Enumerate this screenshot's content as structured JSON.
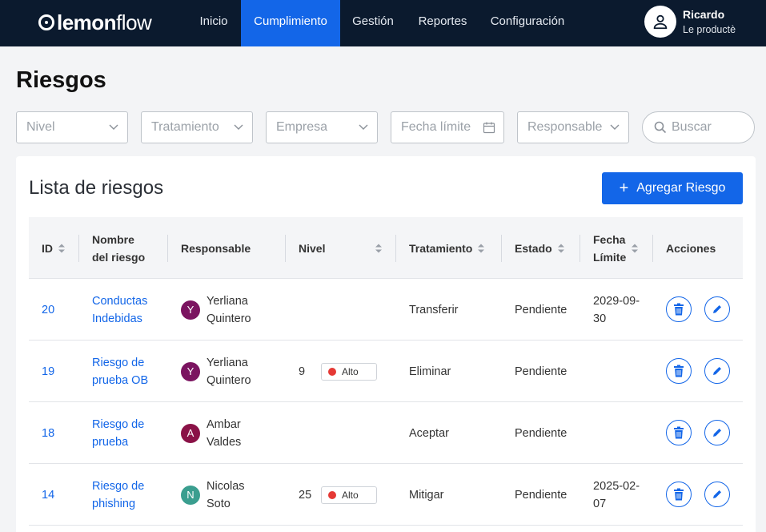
{
  "brand": {
    "logo_bold": "lemon",
    "logo_light": "flow"
  },
  "nav": [
    {
      "label": "Inicio",
      "active": false
    },
    {
      "label": "Cumplimiento",
      "active": true
    },
    {
      "label": "Gestión",
      "active": false
    },
    {
      "label": "Reportes",
      "active": false
    },
    {
      "label": "Configuración",
      "active": false
    }
  ],
  "user": {
    "name": "Ricardo",
    "role": "Le productè",
    "icon": "user-icon"
  },
  "page": {
    "title": "Riesgos"
  },
  "filters": {
    "nivel": "Nivel",
    "tratamiento": "Tratamiento",
    "empresa": "Empresa",
    "fecha_limite": "Fecha límite",
    "responsable": "Responsable",
    "search_placeholder": "Buscar"
  },
  "list": {
    "title": "Lista de riesgos",
    "add_button": "Agregar Riesgo",
    "columns": {
      "id": "ID",
      "nombre_1": "Nombre",
      "nombre_2": "del riesgo",
      "responsable": "Responsable",
      "nivel": "Nivel",
      "tratamiento": "Tratamiento",
      "estado": "Estado",
      "fecha_1": "Fecha",
      "fecha_2": "Límite",
      "acciones": "Acciones"
    },
    "rows": [
      {
        "id": "20",
        "name_1": "Conductas",
        "name_2": "Indebidas",
        "initial": "Y",
        "avatar_color": "#7b1460",
        "resp_1": "Yerliana",
        "resp_2": "Quintero",
        "level_num": "",
        "level_label": "",
        "treatment": "Transferir",
        "status": "Pendiente",
        "date_1": "2029-09-",
        "date_2": "30"
      },
      {
        "id": "19",
        "name_1": "Riesgo de",
        "name_2": "prueba OB",
        "initial": "Y",
        "avatar_color": "#7b1460",
        "resp_1": "Yerliana",
        "resp_2": "Quintero",
        "level_num": "9",
        "level_label": "Alto",
        "treatment": "Eliminar",
        "status": "Pendiente",
        "date_1": "",
        "date_2": ""
      },
      {
        "id": "18",
        "name_1": "Riesgo de",
        "name_2": "prueba",
        "initial": "A",
        "avatar_color": "#8a1247",
        "resp_1": "Ambar",
        "resp_2": "Valdes",
        "level_num": "",
        "level_label": "",
        "treatment": "Aceptar",
        "status": "Pendiente",
        "date_1": "",
        "date_2": ""
      },
      {
        "id": "14",
        "name_1": "Riesgo de",
        "name_2": "phishing",
        "initial": "N",
        "avatar_color": "#3a9e8f",
        "resp_1": "Nicolas",
        "resp_2": "Soto",
        "level_num": "25",
        "level_label": "Alto",
        "treatment": "Mitigar",
        "status": "Pendiente",
        "date_1": "2025-02-",
        "date_2": "07"
      }
    ]
  },
  "colors": {
    "nav_bg": "#0b1a2e",
    "accent": "#1366e8",
    "level_high": "#e53935"
  }
}
